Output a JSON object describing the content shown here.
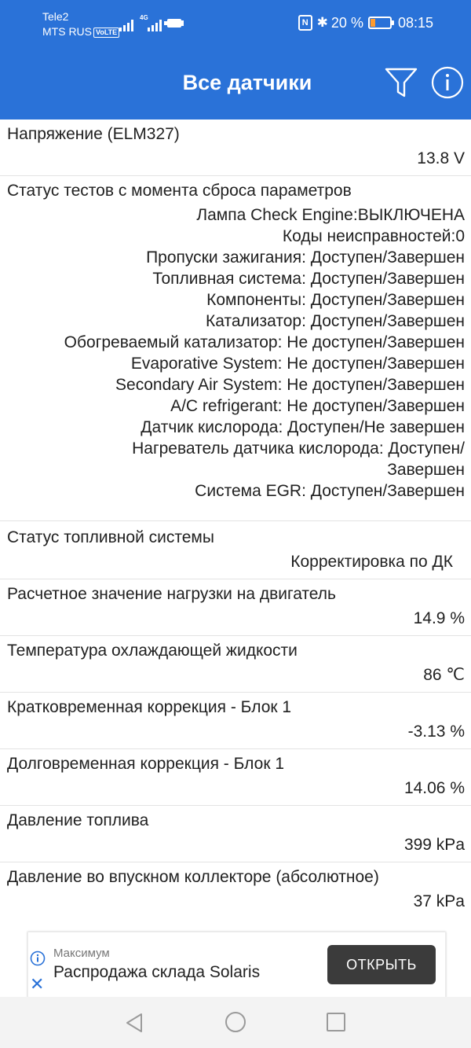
{
  "status_bar": {
    "carrier1": "Tele2",
    "carrier2": "MTS RUS",
    "volte": "VoLTE",
    "network": "4G",
    "battery": "20 %",
    "time": "08:15"
  },
  "app_bar": {
    "title": "Все датчики"
  },
  "sensors": {
    "voltage": {
      "label": "Напряжение (ELM327)",
      "value": "13.8 V"
    },
    "tests": {
      "label": "Статус тестов с момента сброса параметров",
      "lines": [
        "Лампа Check Engine:ВЫКЛЮЧЕНА",
        "Коды неисправностей:0",
        "Пропуски зажигания: Доступен/Завершен",
        "Топливная система: Доступен/Завершен",
        "Компоненты: Доступен/Завершен",
        "Катализатор: Доступен/Завершен",
        "Обогреваемый катализатор: Не доступен/Завершен",
        "Evaporative System: Не доступен/Завершен",
        "Secondary Air System: Не доступен/Завершен",
        "A/C refrigerant: Не доступен/Завершен",
        "Датчик кислорода: Доступен/Не завершен",
        "Нагреватель датчика кислорода: Доступен/",
        "Завершен",
        "Система EGR: Доступен/Завершен"
      ]
    },
    "fuel_status": {
      "label": "Статус топливной системы",
      "value": "Корректировка по ДК"
    },
    "engine_load": {
      "label": "Расчетное значение нагрузки на двигатель",
      "value": "14.9 %"
    },
    "coolant_temp": {
      "label": "Температура охлаждающей жидкости",
      "value": "86 ℃"
    },
    "short_trim": {
      "label": "Кратковременная коррекция - Блок 1",
      "value": "-3.13 %"
    },
    "long_trim": {
      "label": "Долговременная коррекция - Блок 1",
      "value": "14.06 %"
    },
    "fuel_pressure": {
      "label": "Давление топлива",
      "value": "399 kPa"
    },
    "map": {
      "label": "Давление во впускном коллекторе (абсолютное)",
      "value": "37 kPa"
    }
  },
  "ad": {
    "brand": "Максимум",
    "text": "Распродажа склада Solaris",
    "button": "ОТКРЫТЬ"
  },
  "icons": {
    "filter": "filter-icon",
    "info": "info-icon",
    "close": "close-icon",
    "back": "back-icon",
    "home": "home-icon",
    "recent": "recent-apps-icon"
  },
  "colors": {
    "app_bar": "#2a72d8",
    "ad_button": "#3b3b3b",
    "nav_bar": "#f3f3f3"
  }
}
